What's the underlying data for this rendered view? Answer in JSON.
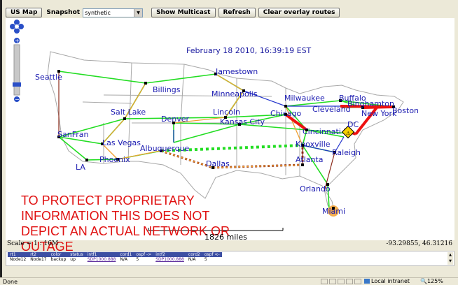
{
  "toolbar": {
    "us_map_label": "US Map",
    "snapshot_label": "Snapshot",
    "snapshot_value": "synthetic",
    "show_multicast_label": "Show Multicast",
    "refresh_label": "Refresh",
    "clear_overlay_label": "Clear overlay routes"
  },
  "map": {
    "date": "February 18 2010, 16:39:19 EST",
    "cities": [
      {
        "name": "Seattle"
      },
      {
        "name": "Jamestown"
      },
      {
        "name": "Billings"
      },
      {
        "name": "Minneapolis"
      },
      {
        "name": "Milwaukee"
      },
      {
        "name": "Buffalo"
      },
      {
        "name": "Binghamton"
      },
      {
        "name": "Cleveland"
      },
      {
        "name": "New York"
      },
      {
        "name": "Boston"
      },
      {
        "name": "Salt Lake"
      },
      {
        "name": "Lincoln"
      },
      {
        "name": "Denver"
      },
      {
        "name": "Kansas City"
      },
      {
        "name": "Chicago"
      },
      {
        "name": "DC"
      },
      {
        "name": "Cincinnati"
      },
      {
        "name": "SanFran"
      },
      {
        "name": "Las Vegas"
      },
      {
        "name": "Albuquerque"
      },
      {
        "name": "Knoxville"
      },
      {
        "name": "Raleigh"
      },
      {
        "name": "Phoenix"
      },
      {
        "name": "LA"
      },
      {
        "name": "Dallas"
      },
      {
        "name": "Atlanta"
      },
      {
        "name": "Orlando"
      },
      {
        "name": "Miami"
      }
    ],
    "disclaimer": "TO PROTECT PROPRIETARY INFORMATION THIS DOES NOT DEPICT AN ACTUAL NETWORK OR OUTAGE",
    "scale_distance": "1826 miles",
    "scale_ratio": "Scale = 1 : 16M",
    "coordinates": "-93.29855, 46.31216",
    "colors": {
      "link_ok": "#22dd22",
      "link_blue": "#2233cc",
      "link_orange": "#f0a030",
      "link_brown": "#8b2a1a",
      "link_red": "#ee1111",
      "label": "#1a1ab0",
      "disclaimer": "#e01010"
    }
  },
  "table": {
    "headers": [
      "rt1",
      "rt2",
      "color",
      "status",
      "intf1",
      "cord1",
      "ospf ->",
      "intf2",
      "cord2",
      "ospf <-"
    ],
    "rows": [
      [
        "Node12",
        "Node17",
        "backup",
        "up",
        "SDP1000.888",
        "N/A",
        "5",
        "SDP1000.888",
        "N/A",
        "5"
      ]
    ]
  },
  "status": {
    "done": "Done",
    "zone": "Local intranet",
    "zoom": "125%"
  },
  "icons": [
    "pan-icon",
    "zoom-in-icon",
    "zoom-out-icon",
    "dropdown-arrow-icon",
    "warning-icon",
    "scroll-up-icon",
    "scroll-down-icon"
  ]
}
